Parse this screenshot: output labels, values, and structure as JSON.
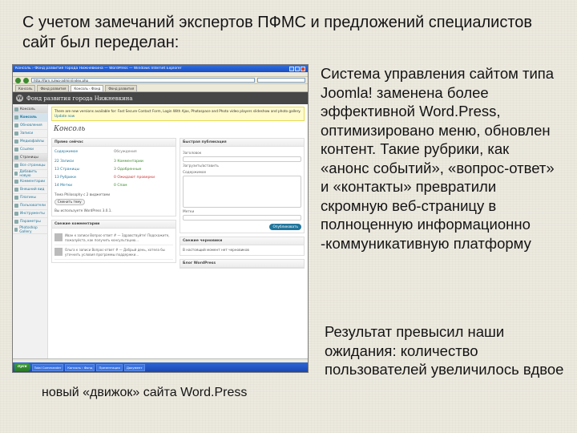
{
  "slide": {
    "title": "С учетом замечаний экспертов ПФМС и предложений специалистов сайт был переделан:",
    "description_1": "Система управления сайтом типа Joomla! заменена более эффективной Word.Press, оптимизировано меню, обновлен контент. Такие рубрики, как «анонс событий», «вопрос-ответ» и «контакты» превратили скромную веб-страницу в полноценную информационно -коммуникативную платформу",
    "description_2": "Результат превысил наши ожидания: количество пользователей увеличилось вдвое",
    "caption": "новый «движок» сайта Word.Press"
  },
  "screenshot": {
    "browser_title": "Консоль › Фонд развития города Нижневкина — WordPress — Windows Internet Explorer",
    "address": "http://fgrn.ru/wp-admin/index.php",
    "tabs": [
      "Консоль",
      "Фонд развития",
      "Консоль ‹ Фонд",
      "Фонд развития"
    ],
    "wp_site_name": "Фонд развития города Нижневкина",
    "sidebar": [
      {
        "label": "Консоль",
        "icon": "dashboard-icon",
        "head": true
      },
      {
        "label": "Консоль",
        "icon": "dashboard-icon",
        "selected": true
      },
      {
        "label": "Обновления",
        "icon": "update-icon"
      },
      {
        "label": "Записи",
        "icon": "pin-icon"
      },
      {
        "label": "Медиафайлы",
        "icon": "media-icon"
      },
      {
        "label": "Ссылки",
        "icon": "link-icon"
      },
      {
        "label": "Страницы",
        "icon": "page-icon",
        "head": true
      },
      {
        "label": "Все страницы",
        "icon": "page-icon"
      },
      {
        "label": "Добавить новую",
        "icon": "page-icon"
      },
      {
        "label": "Комментарии",
        "icon": "comments-icon"
      },
      {
        "label": "Внешний вид",
        "icon": "appearance-icon"
      },
      {
        "label": "Плагины",
        "icon": "plugin-icon"
      },
      {
        "label": "Пользователи",
        "icon": "users-icon"
      },
      {
        "label": "Инструменты",
        "icon": "tools-icon"
      },
      {
        "label": "Параметры",
        "icon": "settings-icon"
      },
      {
        "label": "Photoshop Gallery",
        "icon": "gallery-icon"
      }
    ],
    "notice_text": "There are new versions available for: Fast Secure Contact Form, Login With Ajax, Photospace and Photo video players slideshow and photo gallery.",
    "notice_link": "Update now",
    "dashboard_title": "Консоль",
    "right_now": {
      "header": "Прямо сейчас",
      "sub_content": "Содержимое",
      "sub_discussion": "Обсуждения",
      "rows": [
        {
          "count": "22",
          "label": "Записи",
          "c_count": "3",
          "c_label": "Комментарии"
        },
        {
          "count": "13",
          "label": "Страницы",
          "c_count": "3",
          "c_label": "Одобренные"
        },
        {
          "count": "13",
          "label": "Рубрики",
          "c_count": "0",
          "c_label": "Ожидают проверки",
          "red": true
        },
        {
          "count": "14",
          "label": "Метки",
          "c_count": "0",
          "c_label": "Спам"
        }
      ],
      "theme_text": "Тема Philosophy с 2 виджетами",
      "theme_button": "Сменить тему",
      "version_text": "Вы используете WordPress 3.0.1."
    },
    "recent_comments": {
      "header": "Свежие комментарии",
      "items": [
        "Иван к записи Вопрос-ответ # — Здравствуйте! Подскажите, пожалуйста, как получить консультацию...",
        "Ольга к записи Вопрос-ответ # — Добрый день, хотела бы уточнить условия программы поддержки..."
      ]
    },
    "quick_press": {
      "header": "Быстрая публикация",
      "title_label": "Заголовок",
      "upload_label": "Загрузить/вставить",
      "content_label": "Содержимое",
      "tags_label": "Метки",
      "publish_button": "Опубликовать"
    },
    "recent_drafts": {
      "header": "Свежие черновики",
      "text": "В настоящий момент нет черновиков"
    },
    "wp_blog": {
      "header": "Блог WordPress"
    },
    "taskbar": {
      "start_label": "пуск",
      "items": [
        "Total Commander",
        "Консоль ‹ Фонд",
        "Презентация",
        "Документ"
      ]
    }
  }
}
